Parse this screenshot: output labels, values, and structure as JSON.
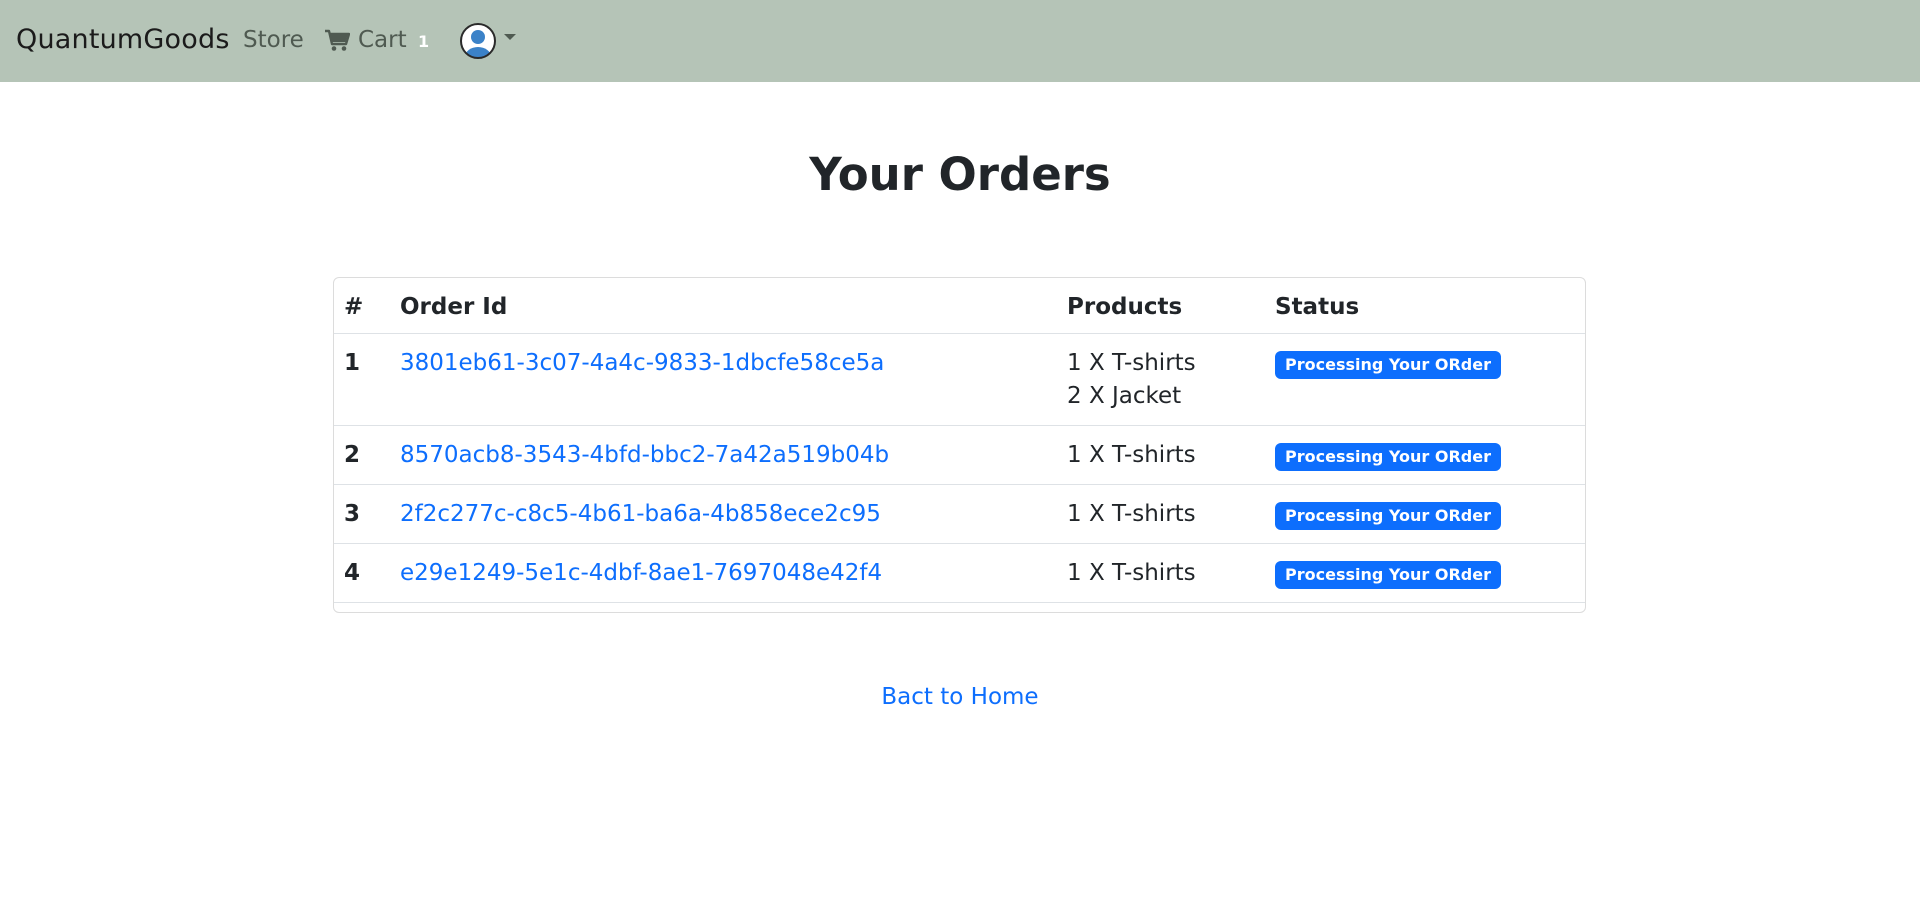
{
  "navbar": {
    "brand": "QuantumGoods",
    "store_label": "Store",
    "cart_label": "Cart",
    "cart_count": "1",
    "cart_icon": "cart-icon",
    "avatar_icon": "user-avatar-icon",
    "background_color": "#b5c4b7"
  },
  "page": {
    "title": "Your Orders"
  },
  "table": {
    "headers": [
      "#",
      "Order Id",
      "Products",
      "Status"
    ],
    "rows": [
      {
        "num": "1",
        "order_id": "3801eb61-3c07-4a4c-9833-1dbcfe58ce5a",
        "products": [
          "1 X T-shirts",
          "2 X Jacket"
        ],
        "status": "Processing Your ORder"
      },
      {
        "num": "2",
        "order_id": "8570acb8-3543-4bfd-bbc2-7a42a519b04b",
        "products": [
          "1 X T-shirts"
        ],
        "status": "Processing Your ORder"
      },
      {
        "num": "3",
        "order_id": "2f2c277c-c8c5-4b61-ba6a-4b858ece2c95",
        "products": [
          "1 X T-shirts"
        ],
        "status": "Processing Your ORder"
      },
      {
        "num": "4",
        "order_id": "e29e1249-5e1c-4dbf-8ae1-7697048e42f4",
        "products": [
          "1 X T-shirts"
        ],
        "status": "Processing Your ORder"
      }
    ]
  },
  "footer": {
    "back_link": "Bact to Home"
  },
  "colors": {
    "link": "#0d6efd",
    "badge": "#0d6efd"
  }
}
